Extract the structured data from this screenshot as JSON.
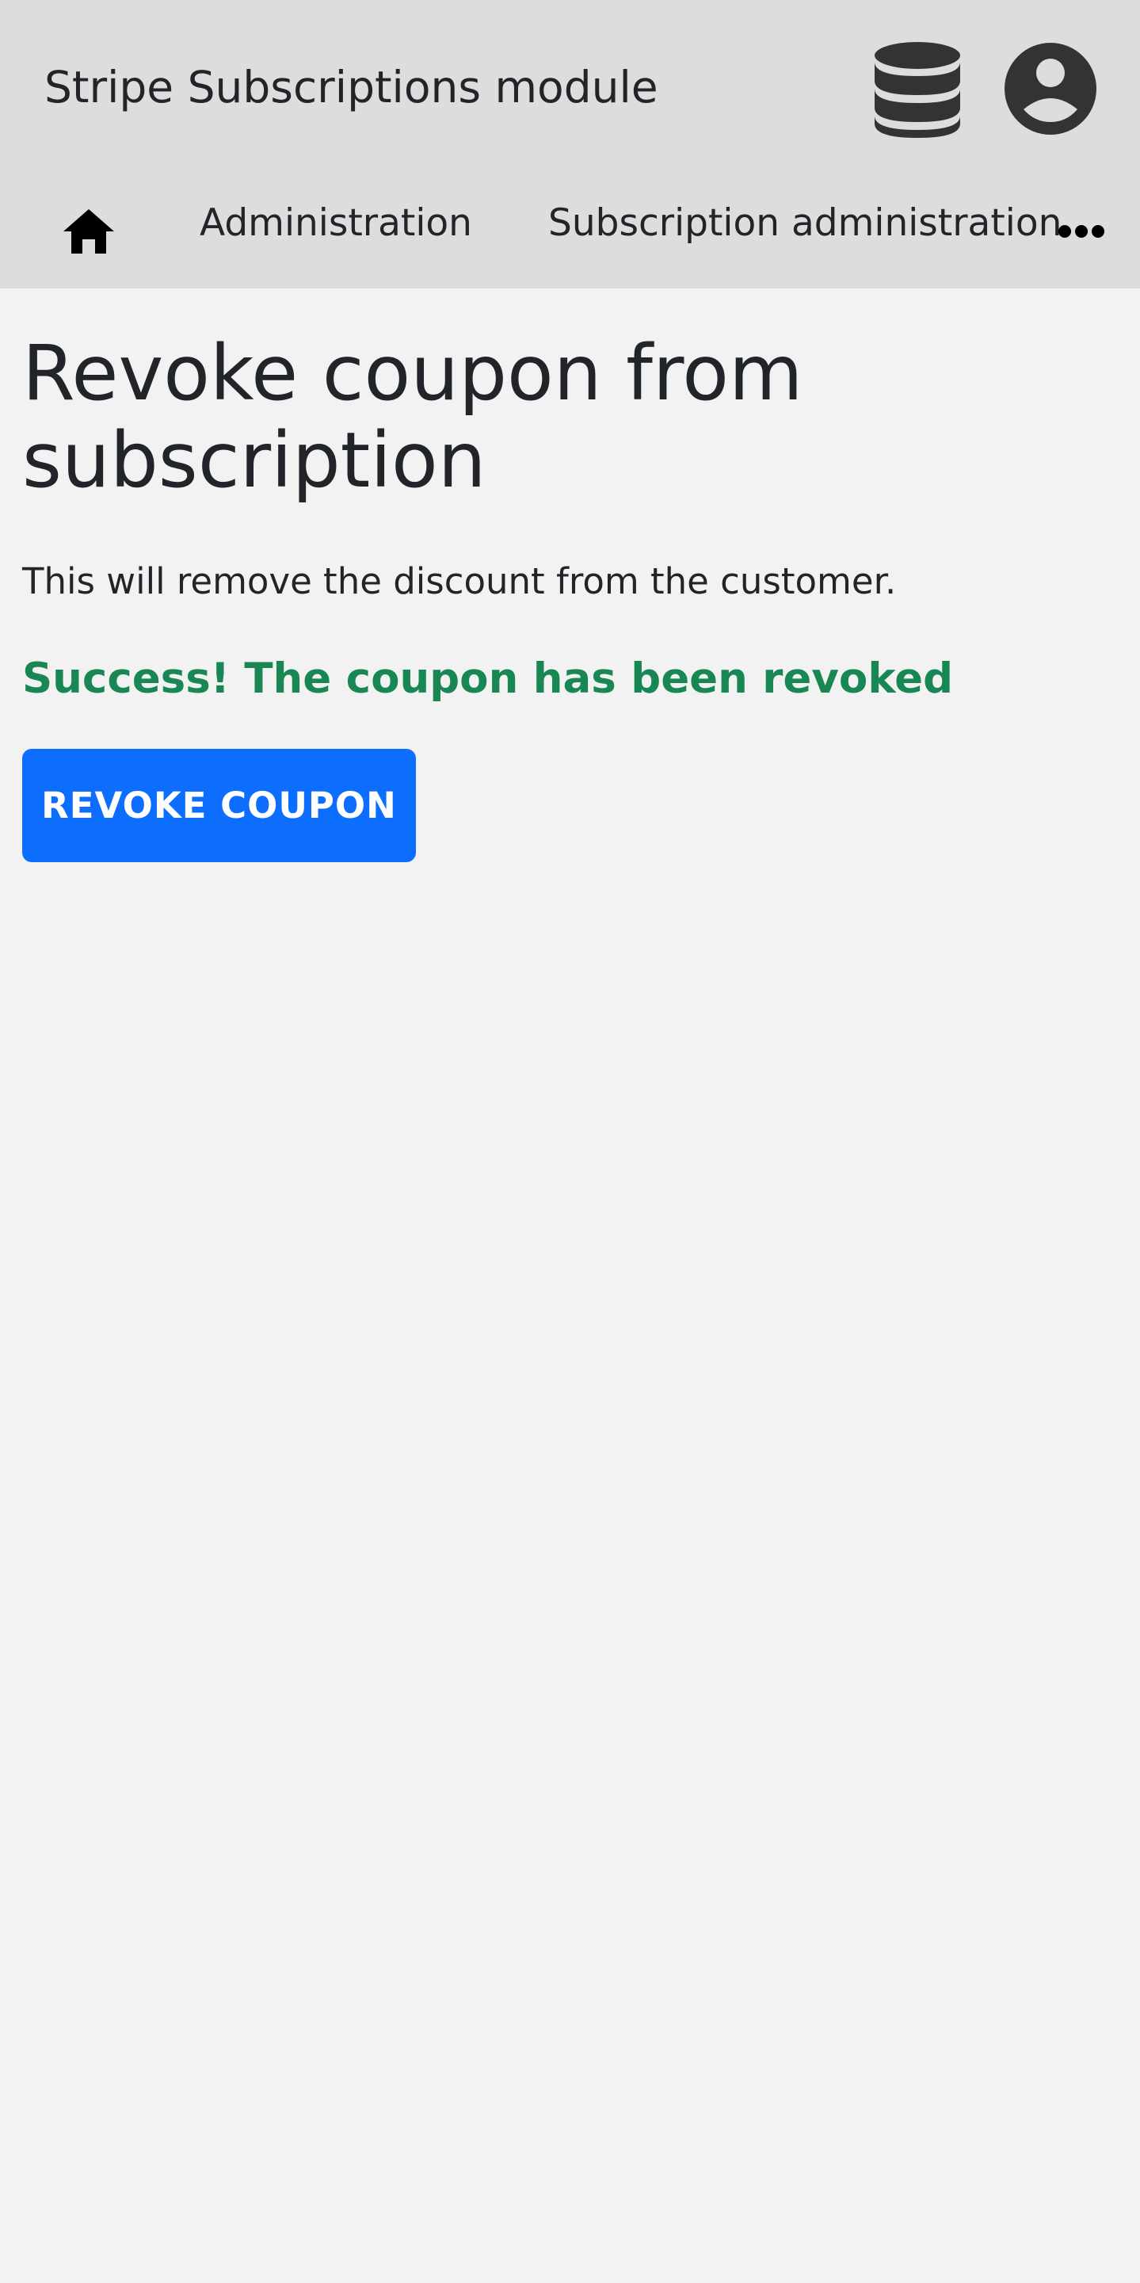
{
  "header": {
    "app_title": "Stripe Subscriptions module",
    "background_color": "#dddddd",
    "icons": [
      "database-icon",
      "account-circle-icon"
    ]
  },
  "nav": {
    "home_icon": "home-icon",
    "items": [
      {
        "label": "Administration"
      },
      {
        "label": "Subscription administration"
      }
    ],
    "overflow_icon": "more-horizontal-icon"
  },
  "main": {
    "title": "Revoke coupon from subscription",
    "description": "This will remove the discount from the customer.",
    "success_message": "Success! The coupon has been revoked",
    "revoke_button_label": "REVOKE COUPON"
  },
  "colors": {
    "page_background": "#f2f2f2",
    "text": "#212529",
    "icon": "#333333",
    "success": "#198754",
    "primary": "#0d6efd"
  }
}
